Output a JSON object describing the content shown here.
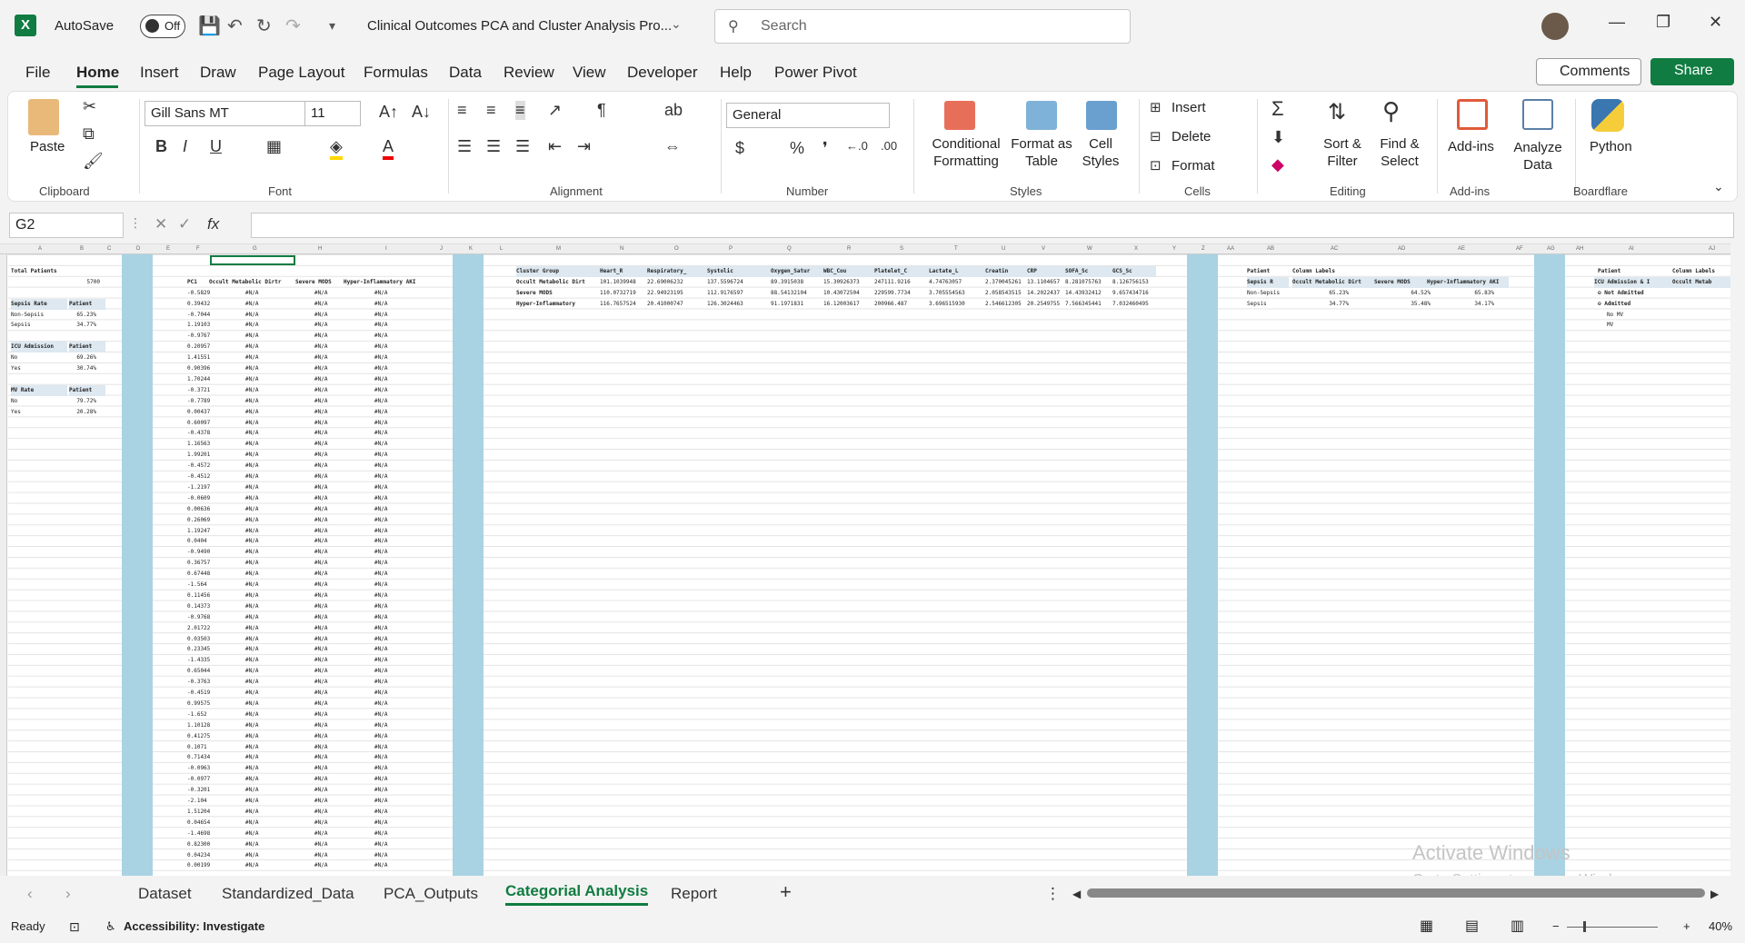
{
  "title_bar": {
    "autosave_label": "AutoSave",
    "autosave_state": "Off",
    "document_title": "Clinical Outcomes PCA and Cluster Analysis Pro...",
    "search_placeholder": "Search"
  },
  "menu": {
    "items": [
      "File",
      "Home",
      "Insert",
      "Draw",
      "Page Layout",
      "Formulas",
      "Data",
      "Review",
      "View",
      "Developer",
      "Help",
      "Power Pivot"
    ],
    "active": "Home",
    "comments_label": "Comments",
    "share_label": "Share"
  },
  "ribbon": {
    "clipboard": {
      "paste": "Paste",
      "label": "Clipboard"
    },
    "font": {
      "name": "Gill Sans MT",
      "size": "11",
      "label": "Font"
    },
    "alignment": {
      "label": "Alignment"
    },
    "number": {
      "format": "General",
      "label": "Number"
    },
    "styles": {
      "conditional_formatting": "Conditional Formatting",
      "format_as_table": "Format as Table",
      "cell_styles": "Cell Styles",
      "label": "Styles"
    },
    "cells": {
      "insert": "Insert",
      "delete": "Delete",
      "format": "Format",
      "label": "Cells"
    },
    "editing": {
      "sort_filter": "Sort & Filter",
      "find_select": "Find & Select",
      "label": "Editing"
    },
    "addins": {
      "addins": "Add-ins",
      "analyze_data": "Analyze Data",
      "label": "Add-ins"
    },
    "boardflare": {
      "python": "Python",
      "label": "Boardflare"
    }
  },
  "formula_bar": {
    "name_box": "G2",
    "fx": "fx",
    "value": ""
  },
  "sheet": {
    "left_tables": [
      {
        "header": "Total Patients",
        "value": "5700"
      },
      {
        "header": "Sepsis Rate",
        "col": "Patient",
        "rows": [
          [
            "Non-Sepsis",
            "65.23%"
          ],
          [
            "Sepsis",
            "34.77%"
          ]
        ]
      },
      {
        "header": "ICU Admission",
        "col": "Patient",
        "rows": [
          [
            "No",
            "69.26%"
          ],
          [
            "Yes",
            "30.74%"
          ]
        ]
      },
      {
        "header": "MV Rate",
        "col": "Patient",
        "rows": [
          [
            "No",
            "79.72%"
          ],
          [
            "Yes",
            "20.28%"
          ]
        ]
      }
    ],
    "pc_headers": [
      "PC1",
      "Occult Metabolic Dirtr",
      "Severe MODS",
      "Hyper-Inflammatory AKI"
    ],
    "pc1_values": [
      "-0.5829",
      "0.39432",
      "-0.7044",
      "1.19103",
      "-0.9767",
      "0.20957",
      "1.41551",
      "0.90396",
      "1.70244",
      "-0.3721",
      "-0.7789",
      "0.00437",
      "0.60097",
      "-0.4378",
      "1.16563",
      "1.99201",
      "-0.4572",
      "-0.4512",
      "-1.2197",
      "-0.0609",
      "0.00636",
      "0.26069",
      "1.19247",
      "0.0404",
      "-0.9490",
      "0.36757",
      "0.67448",
      "-1.564",
      "0.11456",
      "0.14373",
      "-0.9768",
      "2.01722",
      "0.03503",
      "0.23345",
      "-1.4335",
      "0.65044",
      "-0.3763",
      "-0.4519",
      "0.99575",
      "-1.652",
      "1.10128",
      "0.41275",
      "0.1071",
      "0.71434",
      "-0.0963",
      "-0.0977",
      "-0.3201",
      "-2.104",
      "1.51204",
      "0.04654",
      "-1.4698",
      "0.82300",
      "0.04234",
      "0.00199"
    ],
    "cluster_table": {
      "headers": [
        "Cluster Group",
        "Heart_R",
        "Respiratory_",
        "Systolic",
        "Oxygen_Satur",
        "WBC_Cou",
        "Platelet_C",
        "Lactate_L",
        "Creatin",
        "CRP",
        "SOFA_Sc",
        "GCS_Sc"
      ],
      "rows": [
        [
          "Occult Metabolic Dirt",
          "101.1039948",
          "22.69006232",
          "137.5596724",
          "89.3915038",
          "15.30926373",
          "247111.9216",
          "4.74763057",
          "2.370045261",
          "13.1104657",
          "8.281075763",
          "8.126756153"
        ],
        [
          "Severe MODS",
          "110.0732719",
          "22.94923195",
          "112.9176597",
          "88.54132104",
          "10.43072504",
          "229599.7734",
          "3.705554563",
          "2.058543515",
          "14.2022437",
          "14.43932412",
          "9.657434716"
        ],
        [
          "Hyper-Inflammatory",
          "116.7657524",
          "20.41000747",
          "126.3024463",
          "91.1971831",
          "16.12003617",
          "200966.487",
          "3.696515930",
          "2.546612305",
          "20.2549755",
          "7.566345441",
          "7.032460495"
        ]
      ]
    },
    "sepsis_pivot": {
      "headers": [
        "Patient",
        "Column Labels"
      ],
      "sub_headers": [
        "Sepsis R",
        "Occult Metabolic Dirt",
        "Severe MODS",
        "Hyper-Inflammatory AKI"
      ],
      "rows": [
        [
          "Non-Sepsis",
          "65.23%",
          "64.52%",
          "65.83%"
        ],
        [
          "Sepsis",
          "34.77%",
          "35.48%",
          "34.17%"
        ]
      ]
    },
    "icu_pivot": {
      "headers": [
        "Patient",
        "Column Labels"
      ],
      "sub_headers": [
        "ICU Admission & I",
        "Occult Metab"
      ],
      "rows": [
        "Not Admitted",
        "Admitted",
        "No MV",
        "MV"
      ]
    }
  },
  "tabs": {
    "items": [
      "Dataset",
      "Standardized_Data",
      "PCA_Outputs",
      "Categorial Analysis",
      "Report"
    ],
    "active": "Categorial Analysis"
  },
  "status": {
    "ready": "Ready",
    "accessibility": "Accessibility: Investigate",
    "zoom": "40%"
  },
  "watermark": {
    "line1": "Activate Windows",
    "line2": "Go to Settings to activate Windows."
  }
}
